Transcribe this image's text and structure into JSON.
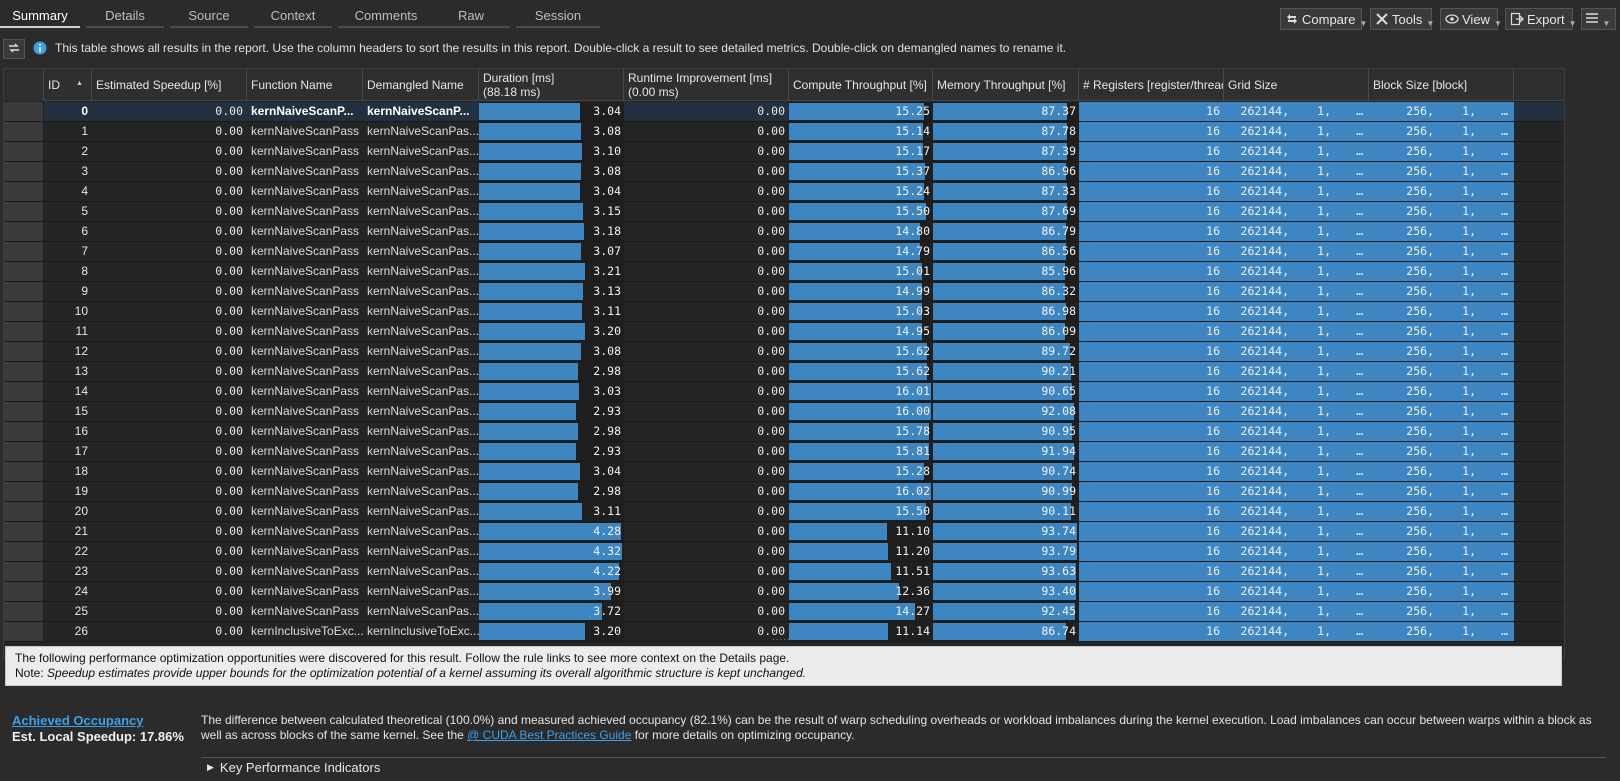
{
  "tabs": [
    "Summary",
    "Details",
    "Source",
    "Context",
    "Comments",
    "Raw",
    "Session"
  ],
  "toolbar": {
    "compare": "Compare",
    "tools": "Tools",
    "view": "View",
    "export": "Export"
  },
  "info_text": "This table shows all results in the report. Use the column headers to sort the results in this report. Double-click a result to see detailed metrics. Double-click on demangled names to rename it.",
  "columns": {
    "id": "ID",
    "speedup": "Estimated Speedup [%]",
    "function": "Function Name",
    "demangled": "Demangled Name",
    "duration": "Duration [ms]",
    "duration_sub": "(88.18 ms)",
    "runtime": "Runtime Improvement [ms]",
    "runtime_sub": "(0.00 ms)",
    "compute": "Compute Throughput [%]",
    "memory": "Memory Throughput [%]",
    "registers": "# Registers [register/thread]",
    "grid": "Grid Size",
    "block": "Block Size [block]"
  },
  "rows": [
    {
      "id": "0",
      "speedup": "0.00",
      "fn": "kernNaiveScanP...",
      "dm": "kernNaiveScanP...",
      "dur": "3.04",
      "rt": "0.00",
      "comp": "15.25",
      "mem": "87.37",
      "reg": "16",
      "g1": "262144,",
      "g2": "1,",
      "g3": "…",
      "b1": "256,",
      "b2": "1,",
      "b3": "…"
    },
    {
      "id": "1",
      "speedup": "0.00",
      "fn": "kernNaiveScanPass",
      "dm": "kernNaiveScanPas...",
      "dur": "3.08",
      "rt": "0.00",
      "comp": "15.14",
      "mem": "87.78",
      "reg": "16",
      "g1": "262144,",
      "g2": "1,",
      "g3": "…",
      "b1": "256,",
      "b2": "1,",
      "b3": "…"
    },
    {
      "id": "2",
      "speedup": "0.00",
      "fn": "kernNaiveScanPass",
      "dm": "kernNaiveScanPas...",
      "dur": "3.10",
      "rt": "0.00",
      "comp": "15.17",
      "mem": "87.39",
      "reg": "16",
      "g1": "262144,",
      "g2": "1,",
      "g3": "…",
      "b1": "256,",
      "b2": "1,",
      "b3": "…"
    },
    {
      "id": "3",
      "speedup": "0.00",
      "fn": "kernNaiveScanPass",
      "dm": "kernNaiveScanPas...",
      "dur": "3.08",
      "rt": "0.00",
      "comp": "15.37",
      "mem": "86.96",
      "reg": "16",
      "g1": "262144,",
      "g2": "1,",
      "g3": "…",
      "b1": "256,",
      "b2": "1,",
      "b3": "…"
    },
    {
      "id": "4",
      "speedup": "0.00",
      "fn": "kernNaiveScanPass",
      "dm": "kernNaiveScanPas...",
      "dur": "3.04",
      "rt": "0.00",
      "comp": "15.24",
      "mem": "87.33",
      "reg": "16",
      "g1": "262144,",
      "g2": "1,",
      "g3": "…",
      "b1": "256,",
      "b2": "1,",
      "b3": "…"
    },
    {
      "id": "5",
      "speedup": "0.00",
      "fn": "kernNaiveScanPass",
      "dm": "kernNaiveScanPas...",
      "dur": "3.15",
      "rt": "0.00",
      "comp": "15.50",
      "mem": "87.69",
      "reg": "16",
      "g1": "262144,",
      "g2": "1,",
      "g3": "…",
      "b1": "256,",
      "b2": "1,",
      "b3": "…"
    },
    {
      "id": "6",
      "speedup": "0.00",
      "fn": "kernNaiveScanPass",
      "dm": "kernNaiveScanPas...",
      "dur": "3.18",
      "rt": "0.00",
      "comp": "14.80",
      "mem": "86.79",
      "reg": "16",
      "g1": "262144,",
      "g2": "1,",
      "g3": "…",
      "b1": "256,",
      "b2": "1,",
      "b3": "…"
    },
    {
      "id": "7",
      "speedup": "0.00",
      "fn": "kernNaiveScanPass",
      "dm": "kernNaiveScanPas...",
      "dur": "3.07",
      "rt": "0.00",
      "comp": "14.79",
      "mem": "86.56",
      "reg": "16",
      "g1": "262144,",
      "g2": "1,",
      "g3": "…",
      "b1": "256,",
      "b2": "1,",
      "b3": "…"
    },
    {
      "id": "8",
      "speedup": "0.00",
      "fn": "kernNaiveScanPass",
      "dm": "kernNaiveScanPas...",
      "dur": "3.21",
      "rt": "0.00",
      "comp": "15.01",
      "mem": "85.96",
      "reg": "16",
      "g1": "262144,",
      "g2": "1,",
      "g3": "…",
      "b1": "256,",
      "b2": "1,",
      "b3": "…"
    },
    {
      "id": "9",
      "speedup": "0.00",
      "fn": "kernNaiveScanPass",
      "dm": "kernNaiveScanPas...",
      "dur": "3.13",
      "rt": "0.00",
      "comp": "14.99",
      "mem": "86.32",
      "reg": "16",
      "g1": "262144,",
      "g2": "1,",
      "g3": "…",
      "b1": "256,",
      "b2": "1,",
      "b3": "…"
    },
    {
      "id": "10",
      "speedup": "0.00",
      "fn": "kernNaiveScanPass",
      "dm": "kernNaiveScanPas...",
      "dur": "3.11",
      "rt": "0.00",
      "comp": "15.03",
      "mem": "86.98",
      "reg": "16",
      "g1": "262144,",
      "g2": "1,",
      "g3": "…",
      "b1": "256,",
      "b2": "1,",
      "b3": "…"
    },
    {
      "id": "11",
      "speedup": "0.00",
      "fn": "kernNaiveScanPass",
      "dm": "kernNaiveScanPas...",
      "dur": "3.20",
      "rt": "0.00",
      "comp": "14.95",
      "mem": "86.09",
      "reg": "16",
      "g1": "262144,",
      "g2": "1,",
      "g3": "…",
      "b1": "256,",
      "b2": "1,",
      "b3": "…"
    },
    {
      "id": "12",
      "speedup": "0.00",
      "fn": "kernNaiveScanPass",
      "dm": "kernNaiveScanPas...",
      "dur": "3.08",
      "rt": "0.00",
      "comp": "15.62",
      "mem": "89.72",
      "reg": "16",
      "g1": "262144,",
      "g2": "1,",
      "g3": "…",
      "b1": "256,",
      "b2": "1,",
      "b3": "…"
    },
    {
      "id": "13",
      "speedup": "0.00",
      "fn": "kernNaiveScanPass",
      "dm": "kernNaiveScanPas...",
      "dur": "2.98",
      "rt": "0.00",
      "comp": "15.62",
      "mem": "90.21",
      "reg": "16",
      "g1": "262144,",
      "g2": "1,",
      "g3": "…",
      "b1": "256,",
      "b2": "1,",
      "b3": "…"
    },
    {
      "id": "14",
      "speedup": "0.00",
      "fn": "kernNaiveScanPass",
      "dm": "kernNaiveScanPas...",
      "dur": "3.03",
      "rt": "0.00",
      "comp": "16.01",
      "mem": "90.65",
      "reg": "16",
      "g1": "262144,",
      "g2": "1,",
      "g3": "…",
      "b1": "256,",
      "b2": "1,",
      "b3": "…"
    },
    {
      "id": "15",
      "speedup": "0.00",
      "fn": "kernNaiveScanPass",
      "dm": "kernNaiveScanPas...",
      "dur": "2.93",
      "rt": "0.00",
      "comp": "16.00",
      "mem": "92.08",
      "reg": "16",
      "g1": "262144,",
      "g2": "1,",
      "g3": "…",
      "b1": "256,",
      "b2": "1,",
      "b3": "…"
    },
    {
      "id": "16",
      "speedup": "0.00",
      "fn": "kernNaiveScanPass",
      "dm": "kernNaiveScanPas...",
      "dur": "2.98",
      "rt": "0.00",
      "comp": "15.78",
      "mem": "90.95",
      "reg": "16",
      "g1": "262144,",
      "g2": "1,",
      "g3": "…",
      "b1": "256,",
      "b2": "1,",
      "b3": "…"
    },
    {
      "id": "17",
      "speedup": "0.00",
      "fn": "kernNaiveScanPass",
      "dm": "kernNaiveScanPas...",
      "dur": "2.93",
      "rt": "0.00",
      "comp": "15.81",
      "mem": "91.94",
      "reg": "16",
      "g1": "262144,",
      "g2": "1,",
      "g3": "…",
      "b1": "256,",
      "b2": "1,",
      "b3": "…"
    },
    {
      "id": "18",
      "speedup": "0.00",
      "fn": "kernNaiveScanPass",
      "dm": "kernNaiveScanPas...",
      "dur": "3.04",
      "rt": "0.00",
      "comp": "15.28",
      "mem": "90.74",
      "reg": "16",
      "g1": "262144,",
      "g2": "1,",
      "g3": "…",
      "b1": "256,",
      "b2": "1,",
      "b3": "…"
    },
    {
      "id": "19",
      "speedup": "0.00",
      "fn": "kernNaiveScanPass",
      "dm": "kernNaiveScanPas...",
      "dur": "2.98",
      "rt": "0.00",
      "comp": "16.02",
      "mem": "90.99",
      "reg": "16",
      "g1": "262144,",
      "g2": "1,",
      "g3": "…",
      "b1": "256,",
      "b2": "1,",
      "b3": "…"
    },
    {
      "id": "20",
      "speedup": "0.00",
      "fn": "kernNaiveScanPass",
      "dm": "kernNaiveScanPas...",
      "dur": "3.11",
      "rt": "0.00",
      "comp": "15.50",
      "mem": "90.11",
      "reg": "16",
      "g1": "262144,",
      "g2": "1,",
      "g3": "…",
      "b1": "256,",
      "b2": "1,",
      "b3": "…"
    },
    {
      "id": "21",
      "speedup": "0.00",
      "fn": "kernNaiveScanPass",
      "dm": "kernNaiveScanPas...",
      "dur": "4.28",
      "rt": "0.00",
      "comp": "11.10",
      "mem": "93.74",
      "reg": "16",
      "g1": "262144,",
      "g2": "1,",
      "g3": "…",
      "b1": "256,",
      "b2": "1,",
      "b3": "…"
    },
    {
      "id": "22",
      "speedup": "0.00",
      "fn": "kernNaiveScanPass",
      "dm": "kernNaiveScanPas...",
      "dur": "4.32",
      "rt": "0.00",
      "comp": "11.20",
      "mem": "93.79",
      "reg": "16",
      "g1": "262144,",
      "g2": "1,",
      "g3": "…",
      "b1": "256,",
      "b2": "1,",
      "b3": "…"
    },
    {
      "id": "23",
      "speedup": "0.00",
      "fn": "kernNaiveScanPass",
      "dm": "kernNaiveScanPas...",
      "dur": "4.22",
      "rt": "0.00",
      "comp": "11.51",
      "mem": "93.63",
      "reg": "16",
      "g1": "262144,",
      "g2": "1,",
      "g3": "…",
      "b1": "256,",
      "b2": "1,",
      "b3": "…"
    },
    {
      "id": "24",
      "speedup": "0.00",
      "fn": "kernNaiveScanPass",
      "dm": "kernNaiveScanPas...",
      "dur": "3.99",
      "rt": "0.00",
      "comp": "12.36",
      "mem": "93.40",
      "reg": "16",
      "g1": "262144,",
      "g2": "1,",
      "g3": "…",
      "b1": "256,",
      "b2": "1,",
      "b3": "…"
    },
    {
      "id": "25",
      "speedup": "0.00",
      "fn": "kernNaiveScanPass",
      "dm": "kernNaiveScanPas...",
      "dur": "3.72",
      "rt": "0.00",
      "comp": "14.27",
      "mem": "92.45",
      "reg": "16",
      "g1": "262144,",
      "g2": "1,",
      "g3": "…",
      "b1": "256,",
      "b2": "1,",
      "b3": "…"
    },
    {
      "id": "26",
      "speedup": "0.00",
      "fn": "kernInclusiveToExc...",
      "dm": "kernInclusiveToExc...",
      "dur": "3.20",
      "rt": "0.00",
      "comp": "11.14",
      "mem": "86.74",
      "reg": "16",
      "g1": "262144,",
      "g2": "1,",
      "g3": "…",
      "b1": "256,",
      "b2": "1,",
      "b3": "…"
    }
  ],
  "splitter": ".....",
  "opportunities": {
    "line1": "The following performance optimization opportunities were discovered for this result. Follow the rule links to see more context on the Details page.",
    "note_label": "Note: ",
    "note_text": "Speedup estimates provide upper bounds for the optimization potential of a kernel assuming its overall algorithmic structure is kept unchanged."
  },
  "occupancy": {
    "title": "Achieved Occupancy",
    "speedup": "Est. Local Speedup: 17.86%",
    "desc_before": "The difference between calculated theoretical (100.0%) and measured achieved occupancy (82.1%) can be the result of warp scheduling overheads or workload imbalances during the kernel execution. Load imbalances can occur between warps within a block as well as across blocks of the same kernel. See the ",
    "link": "CUDA Best Practices Guide",
    "desc_after": " for more details on optimizing occupancy."
  },
  "kpi": "Key Performance Indicators",
  "colors": {
    "bar": "#3d86c1",
    "link": "#3f9fe8",
    "selected_row": "#233040"
  }
}
